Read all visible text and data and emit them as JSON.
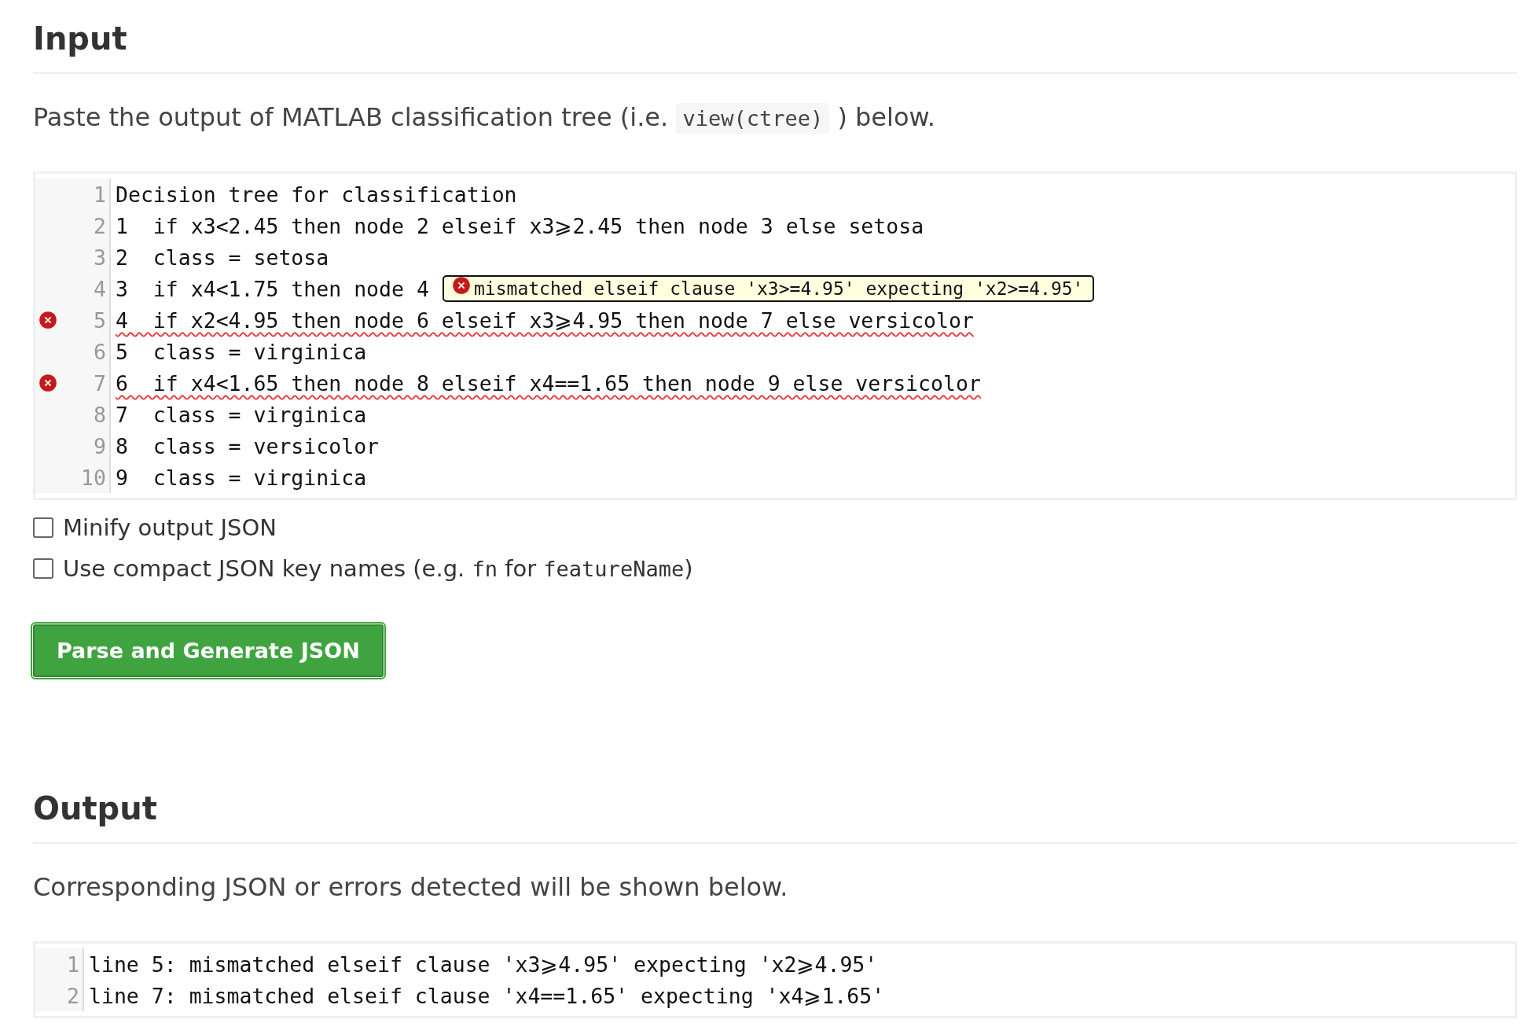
{
  "input": {
    "heading": "Input",
    "intro": [
      {
        "kind": "text",
        "text": "Paste the output of MATLAB classification tree (i.e. "
      },
      {
        "kind": "code",
        "text": "view(ctree)"
      },
      {
        "kind": "text",
        "text": " ) below."
      }
    ],
    "editor": {
      "lines": [
        {
          "number": "1",
          "text": "Decision tree for classification",
          "error": false
        },
        {
          "number": "2",
          "text": "1  if x3<2.45 then node 2 elseif x3⩾2.45 then node 3 else setosa",
          "error": false
        },
        {
          "number": "3",
          "text": "2  class = setosa",
          "error": false
        },
        {
          "number": "4",
          "text": "3  if x4<1.75 then node 4",
          "error": false,
          "tooltip": "mismatched elseif clause 'x3>=4.95' expecting 'x2>=4.95'"
        },
        {
          "number": "5",
          "text": "4  if x2<4.95 then node 6 elseif x3⩾4.95 then node 7 else versicolor",
          "error": true
        },
        {
          "number": "6",
          "text": "5  class = virginica",
          "error": false
        },
        {
          "number": "7",
          "text": "6  if x4<1.65 then node 8 elseif x4==1.65 then node 9 else versicolor",
          "error": true
        },
        {
          "number": "8",
          "text": "7  class = virginica",
          "error": false
        },
        {
          "number": "9",
          "text": "8  class = versicolor",
          "error": false
        },
        {
          "number": "10",
          "text": "9  class = virginica",
          "error": false
        }
      ]
    },
    "options": [
      {
        "checked": false,
        "label": [
          {
            "kind": "text",
            "text": "Minify output JSON"
          }
        ]
      },
      {
        "checked": false,
        "label": [
          {
            "kind": "text",
            "text": "Use compact JSON key names (e.g. "
          },
          {
            "kind": "code",
            "text": "fn"
          },
          {
            "kind": "text",
            "text": " for "
          },
          {
            "kind": "code",
            "text": "featureName"
          },
          {
            "kind": "text",
            "text": ")"
          }
        ]
      }
    ],
    "button": "Parse and Generate JSON"
  },
  "output": {
    "heading": "Output",
    "intro": "Corresponding JSON or errors detected will be shown below.",
    "lines": [
      {
        "number": "1",
        "text": "line 5: mismatched elseif clause 'x3⩾4.95' expecting 'x2⩾4.95'"
      },
      {
        "number": "2",
        "text": "line 7: mismatched elseif clause 'x4==1.65' expecting 'x4⩾1.65'"
      }
    ]
  }
}
